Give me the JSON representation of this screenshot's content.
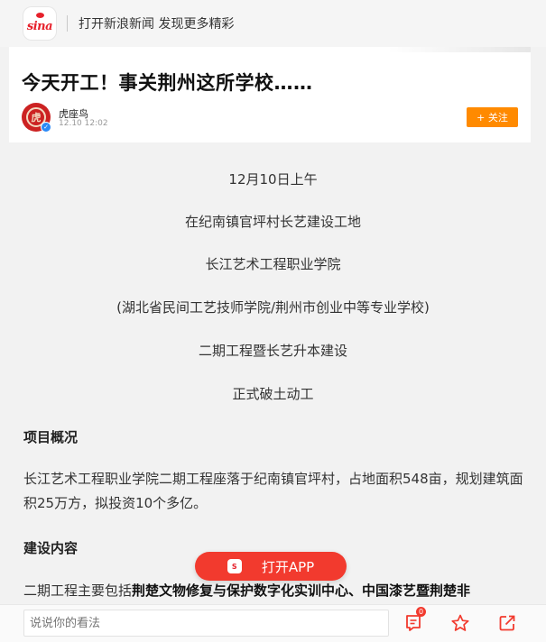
{
  "header": {
    "logo_text": "sina",
    "promo_text": "打开新浪新闻 发现更多精彩"
  },
  "article": {
    "title": "今天开工！事关荆州这所学校……",
    "author": "虎座鸟",
    "time": "12.10 12:02",
    "follow_label": "+ 关注",
    "centered_lines": [
      "12月10日上午",
      "在纪南镇官坪村长艺建设工地",
      "长江艺术工程职业学院",
      "(湖北省民间工艺技师学院/荆州市创业中等专业学校)",
      "二期工程暨长艺升本建设",
      "正式破土动工"
    ],
    "section1_heading": "项目概况",
    "section1_text": "长江艺术工程职业学院二期工程座落于纪南镇官坪村，占地面积548亩，规划建筑面积25万方，拟投资10个多亿。",
    "section2_heading": "建设内容",
    "section2_text_plain": "二期工程主要包括",
    "section2_text_bold": "荆楚文物修复与保护数字化实训中心、中国漆艺暨荆楚非"
  },
  "open_app_label": "打开APP",
  "bottom_bar": {
    "comment_placeholder": "说说你的看法",
    "comment_count": "0"
  },
  "colors": {
    "brand_red": "#e6202b",
    "follow_orange": "#ff8a00",
    "app_button_red": "#f23a2e"
  },
  "icons": [
    "sina-logo-icon",
    "comment-icon",
    "star-icon",
    "share-icon"
  ]
}
